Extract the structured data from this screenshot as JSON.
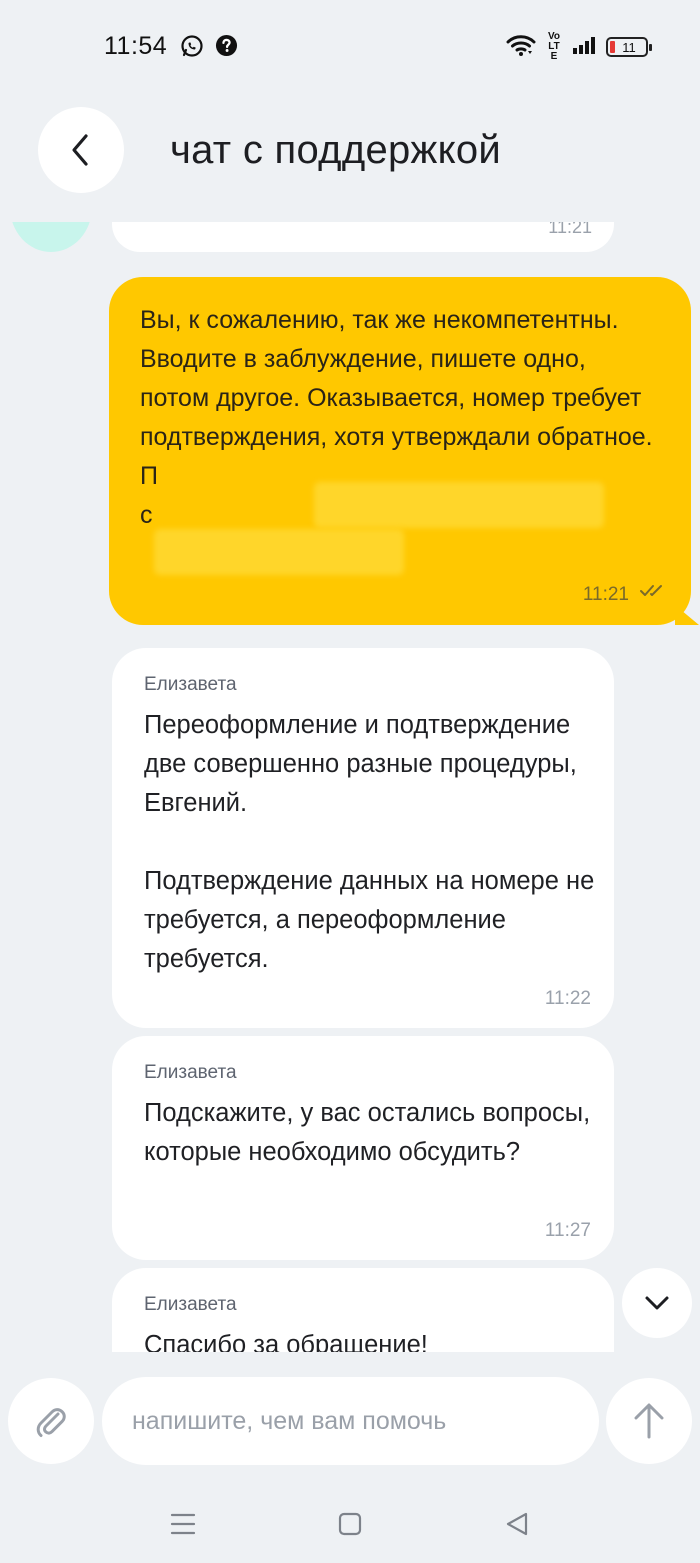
{
  "status_bar": {
    "time": "11:54",
    "notification_icons": [
      "whatsapp-icon",
      "help-icon"
    ],
    "volte_label": "Vo LTE",
    "battery_level": "11",
    "icons": [
      "wifi-icon",
      "signal-icon",
      "battery-icon"
    ]
  },
  "header": {
    "back_icon": "chevron-left-icon",
    "title": "чат с поддержкой"
  },
  "messages": [
    {
      "direction": "in",
      "time": "11:21",
      "partially_visible": true
    },
    {
      "direction": "out",
      "text": "Вы, к сожалению, так же некомпетентны. Вводите в заблуждение, пишете одно, потом другое. Оказывается, номер требует подтверждения, хотя утверждали обратное. П",
      "redacted_tail": "с",
      "time": "11:21",
      "status_icon": "double-check-icon"
    },
    {
      "direction": "in",
      "sender": "Елизавета",
      "text_p1": "Переоформление и подтверждение две совершенно разные процедуры, Евгений.",
      "text_p2": "Подтверждение данных на номере не требуется, а переоформление требуется.",
      "time": "11:22"
    },
    {
      "direction": "in",
      "sender": "Елизавета",
      "text": "Подскажите, у вас остались вопросы, которые необходимо обсудить?",
      "time": "11:27"
    },
    {
      "direction": "in",
      "sender": "Елизавета",
      "text": "Спасибо за обращение!",
      "partially_visible": true
    }
  ],
  "composer": {
    "attach_icon": "paperclip-icon",
    "placeholder": "напишите, чем вам помочь",
    "value": "",
    "send_icon": "arrow-up-icon"
  },
  "scroll_button_icon": "chevron-down-icon",
  "nav_bar": {
    "icons": [
      "menu-icon",
      "home-square-icon",
      "back-triangle-icon"
    ]
  },
  "colors": {
    "background": "#eef1f4",
    "outgoing_bubble": "#ffc800",
    "incoming_bubble": "#ffffff",
    "avatar": "#c8f5ec",
    "battery_low": "#e53935"
  }
}
